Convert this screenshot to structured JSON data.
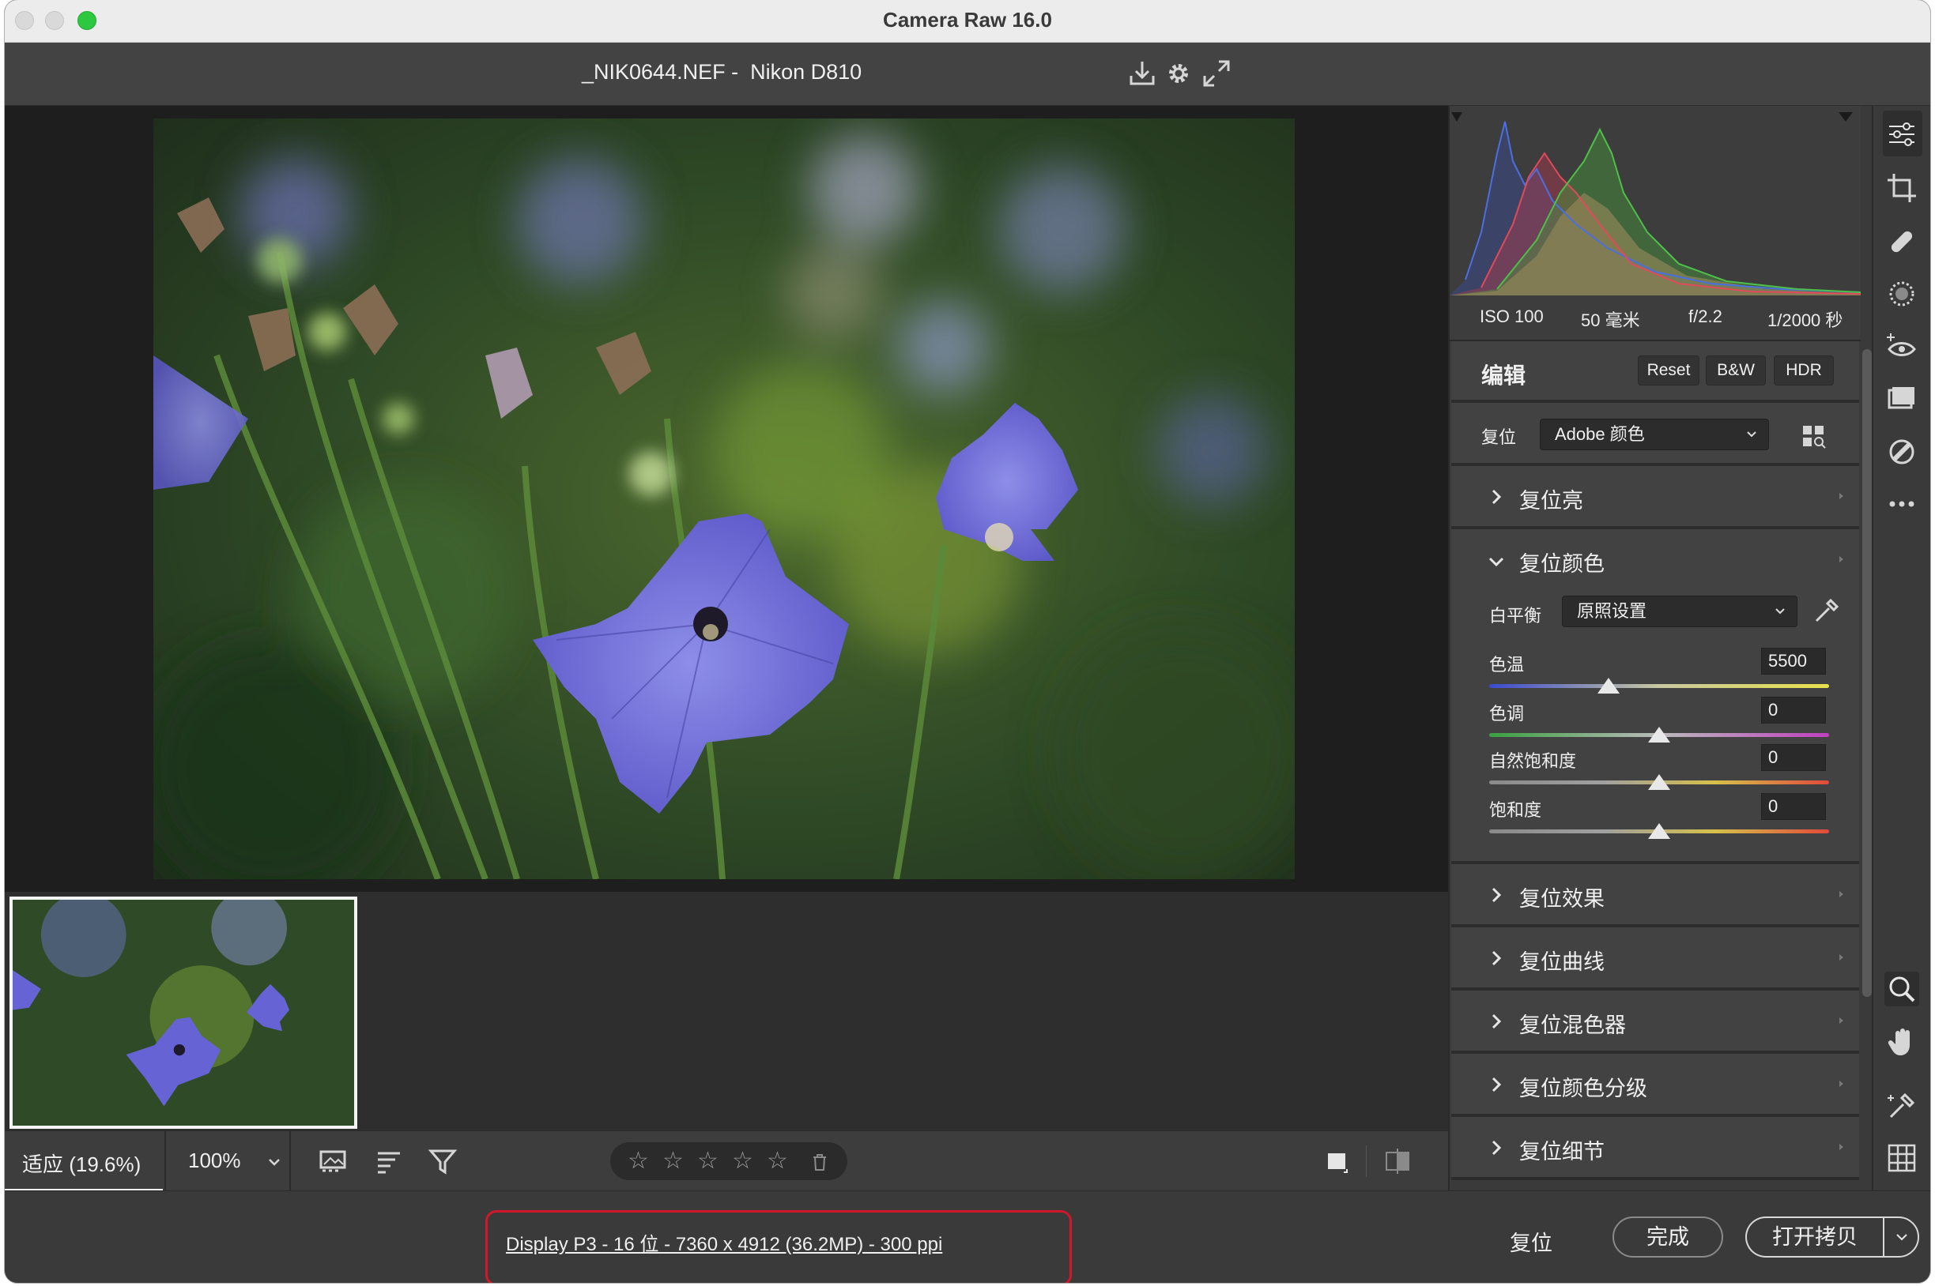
{
  "window": {
    "title": "Camera Raw 16.0"
  },
  "document": {
    "name": "_NIK0644.NEF -  Nikon D810"
  },
  "exif": {
    "iso": "ISO 100",
    "focal": "50 毫米",
    "aperture": "f/2.2",
    "shutter": "1/2000 秒"
  },
  "edit": {
    "title": "编辑",
    "reset_label": "Reset",
    "bw_label": "B&W",
    "hdr_label": "HDR",
    "profile_label": "复位",
    "profile_value": "Adobe 颜色"
  },
  "sections": {
    "light": "复位亮",
    "color": "复位颜色",
    "effects": "复位效果",
    "curve": "复位曲线",
    "mixer": "复位混色器",
    "grading": "复位颜色分级",
    "detail": "复位细节"
  },
  "color_panel": {
    "wb_label": "白平衡",
    "wb_value": "原照设置",
    "temp_label": "色温",
    "temp_value": "5500",
    "tint_label": "色调",
    "tint_value": "0",
    "vibrance_label": "自然饱和度",
    "vibrance_value": "0",
    "saturation_label": "饱和度",
    "saturation_value": "0"
  },
  "sliders": {
    "temp_pos": 0.35,
    "tint_pos": 0.5,
    "vibrance_pos": 0.5,
    "saturation_pos": 0.5
  },
  "toolbar": {
    "zoom_fit": "适应 (19.6%)",
    "zoom_100": "100%",
    "stars": "☆",
    "stars_count": 5
  },
  "footer": {
    "file_info": "Display P3 - 16 位 - 7360 x 4912 (36.2MP) - 300 ppi",
    "reset": "复位",
    "done": "完成",
    "open": "打开拷贝"
  },
  "colors": {
    "accent_red": "#d0182a",
    "panel_bg": "#3a3a3a",
    "canvas_bg": "#1e1e1e"
  }
}
